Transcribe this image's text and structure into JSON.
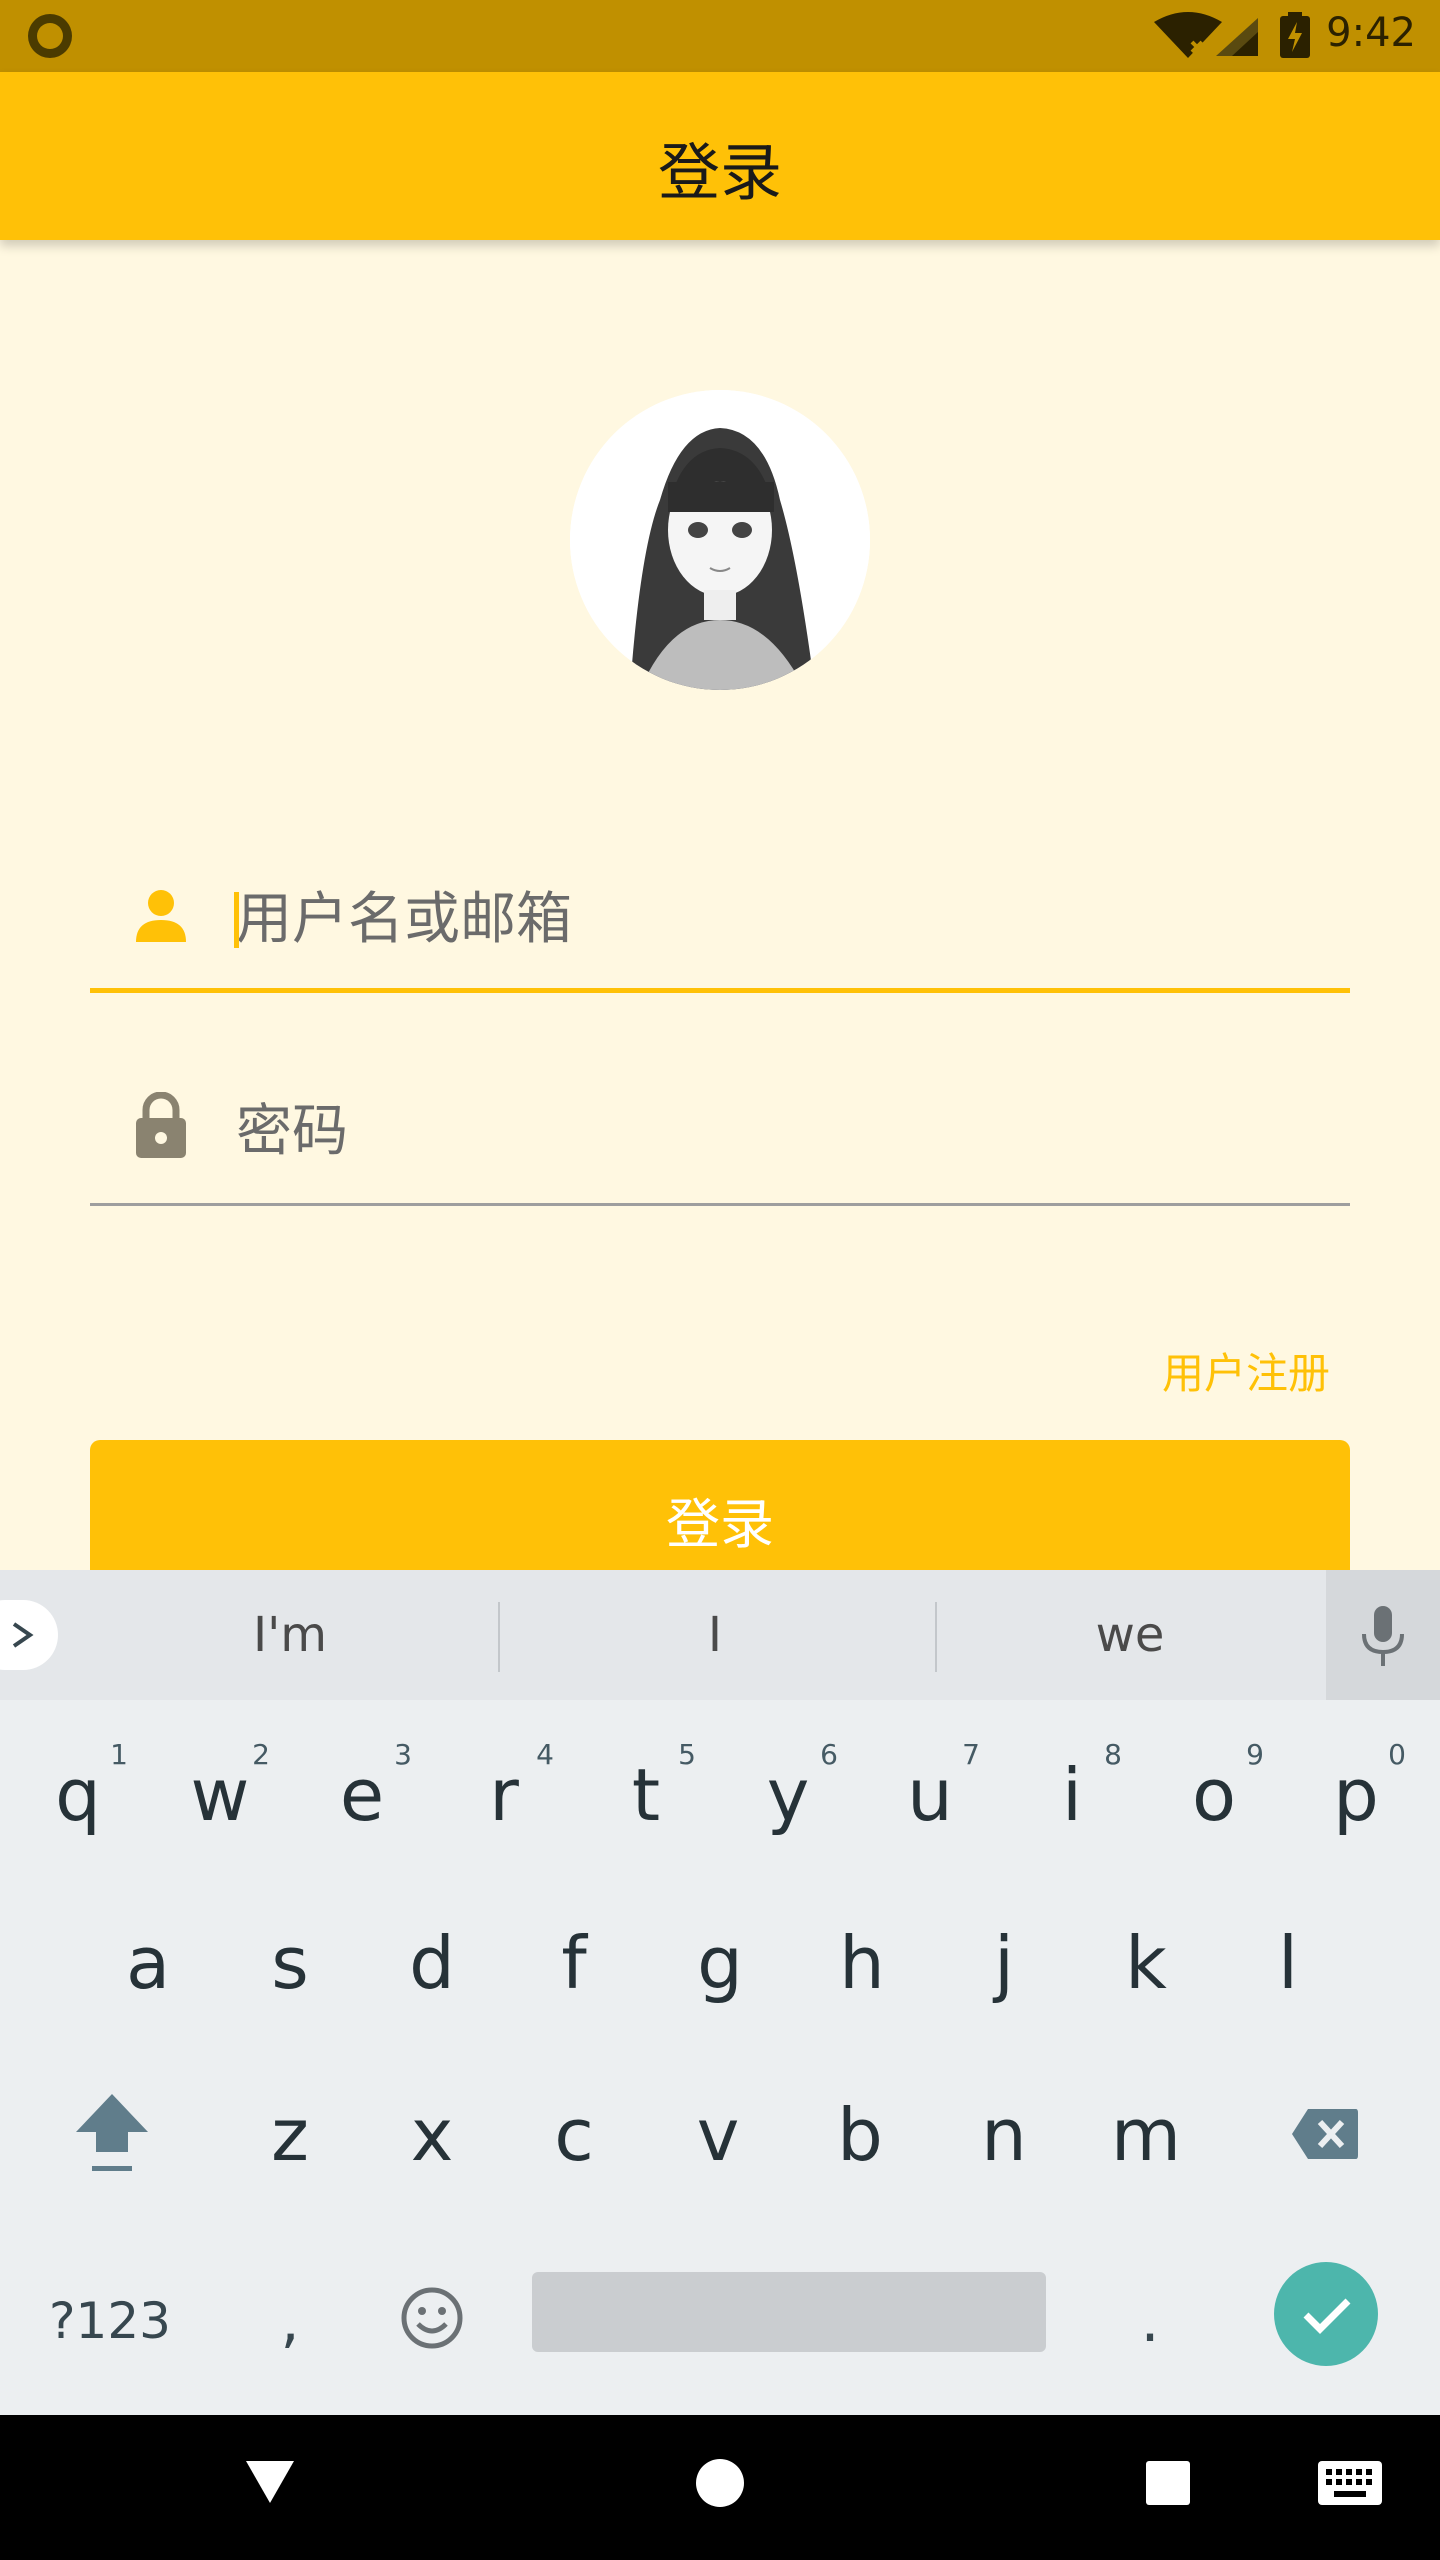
{
  "status_bar": {
    "time": "9:42"
  },
  "app_bar": {
    "title": "登录"
  },
  "avatar": {
    "description_icon": "user-avatar-illustration"
  },
  "form": {
    "username_placeholder": "用户名或邮箱",
    "password_placeholder": "密码",
    "register_link": "用户注册",
    "login_button": "登录"
  },
  "keyboard": {
    "suggestions": [
      "I'm",
      "I",
      "we"
    ],
    "row1": [
      {
        "key": "q",
        "hint": "1"
      },
      {
        "key": "w",
        "hint": "2"
      },
      {
        "key": "e",
        "hint": "3"
      },
      {
        "key": "r",
        "hint": "4"
      },
      {
        "key": "t",
        "hint": "5"
      },
      {
        "key": "y",
        "hint": "6"
      },
      {
        "key": "u",
        "hint": "7"
      },
      {
        "key": "i",
        "hint": "8"
      },
      {
        "key": "o",
        "hint": "9"
      },
      {
        "key": "p",
        "hint": "0"
      }
    ],
    "row2": [
      "a",
      "s",
      "d",
      "f",
      "g",
      "h",
      "j",
      "k",
      "l"
    ],
    "row3": [
      "z",
      "x",
      "c",
      "v",
      "b",
      "n",
      "m"
    ],
    "symbols_label": "?123",
    "comma": ",",
    "period": "."
  },
  "colors": {
    "primary": "#FFC107",
    "status_bar": "#C09000",
    "background": "#FFF8E1",
    "enter_key": "#4DB6AC"
  }
}
